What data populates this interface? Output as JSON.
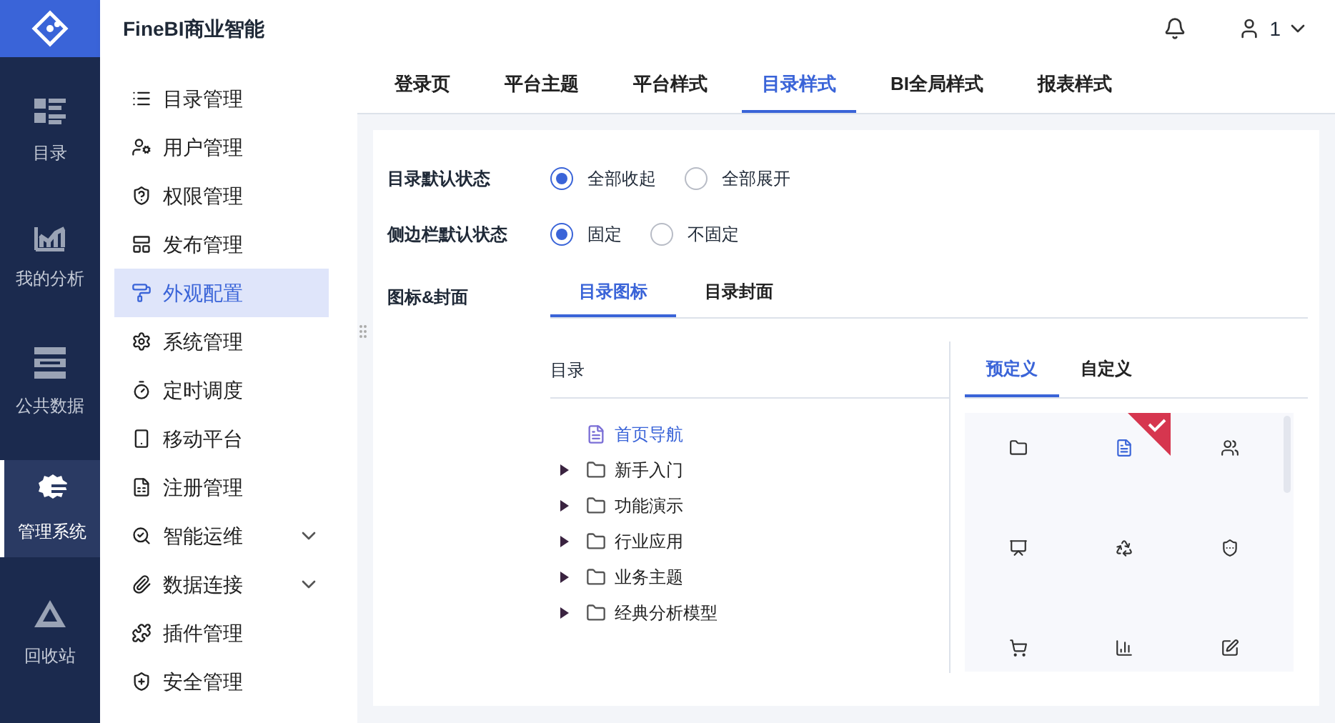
{
  "header": {
    "title": "FineBI商业智能",
    "user": "1"
  },
  "rail": [
    {
      "label": "目录",
      "selected": false
    },
    {
      "label": "我的分析",
      "selected": false
    },
    {
      "label": "公共数据",
      "selected": false
    },
    {
      "label": "管理系统",
      "selected": true
    },
    {
      "label": "回收站",
      "selected": false
    }
  ],
  "menu": [
    {
      "label": "目录管理",
      "selected": false
    },
    {
      "label": "用户管理",
      "selected": false
    },
    {
      "label": "权限管理",
      "selected": false
    },
    {
      "label": "发布管理",
      "selected": false
    },
    {
      "label": "外观配置",
      "selected": true
    },
    {
      "label": "系统管理",
      "selected": false
    },
    {
      "label": "定时调度",
      "selected": false
    },
    {
      "label": "移动平台",
      "selected": false
    },
    {
      "label": "注册管理",
      "selected": false
    },
    {
      "label": "智能运维",
      "selected": false,
      "expanded": false
    },
    {
      "label": "数据连接",
      "selected": false,
      "expanded": false
    },
    {
      "label": "插件管理",
      "selected": false
    },
    {
      "label": "安全管理",
      "selected": false
    }
  ],
  "tabs": [
    {
      "label": "登录页",
      "selected": false
    },
    {
      "label": "平台主题",
      "selected": false
    },
    {
      "label": "平台样式",
      "selected": false
    },
    {
      "label": "目录样式",
      "selected": true
    },
    {
      "label": "BI全局样式",
      "selected": false
    },
    {
      "label": "报表样式",
      "selected": false
    }
  ],
  "settings": [
    {
      "label": "目录默认状态",
      "options": [
        {
          "label": "全部收起",
          "selected": true
        },
        {
          "label": "全部展开",
          "selected": false
        }
      ]
    },
    {
      "label": "侧边栏默认状态",
      "options": [
        {
          "label": "固定",
          "selected": true
        },
        {
          "label": "不固定",
          "selected": false
        }
      ]
    }
  ],
  "icon_cover": {
    "label": "图标&封面",
    "tabs": [
      {
        "label": "目录图标",
        "selected": true
      },
      {
        "label": "目录封面",
        "selected": false
      }
    ],
    "tree_header": "目录",
    "tree": [
      {
        "kind": "file",
        "label": "首页导航",
        "selected": true
      },
      {
        "kind": "folder",
        "label": "新手入门",
        "selected": false,
        "expanded": false
      },
      {
        "kind": "folder",
        "label": "功能演示",
        "selected": false,
        "expanded": false
      },
      {
        "kind": "folder",
        "label": "行业应用",
        "selected": false,
        "expanded": false
      },
      {
        "kind": "folder",
        "label": "业务主题",
        "selected": false,
        "expanded": false
      },
      {
        "kind": "folder",
        "label": "经典分析模型",
        "selected": false,
        "expanded": false
      }
    ],
    "icon_tabs": [
      {
        "label": "预定义",
        "selected": true
      },
      {
        "label": "自定义",
        "selected": false
      }
    ],
    "icons": [
      {
        "selected": false
      },
      {
        "selected": true
      },
      {
        "selected": false
      },
      {
        "selected": false
      },
      {
        "selected": false
      },
      {
        "selected": false
      },
      {
        "selected": false
      },
      {
        "selected": false
      },
      {
        "selected": false
      }
    ]
  }
}
